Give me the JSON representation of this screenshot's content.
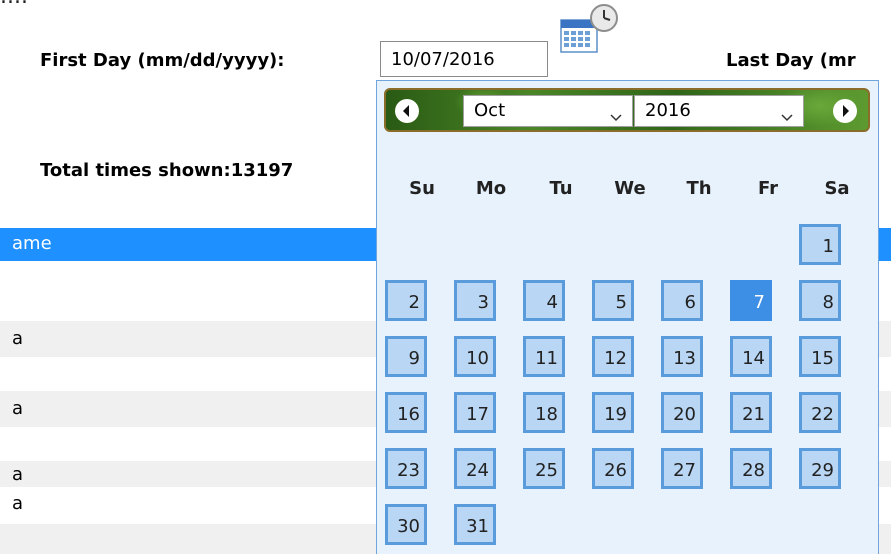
{
  "form": {
    "first_day_label": "First Day (mm/dd/yyyy):",
    "first_day_value": "10/07/2016",
    "last_day_label": "Last Day (mr",
    "total_label": "Total times shown:13197",
    "top_cut_text": "...."
  },
  "table": {
    "header_text": "ame",
    "row_texts": [
      "a",
      "a",
      "a",
      "a"
    ]
  },
  "calendar": {
    "month": "Oct",
    "year": "2016",
    "weekdays": [
      "Su",
      "Mo",
      "Tu",
      "We",
      "Th",
      "Fr",
      "Sa"
    ],
    "selected_day": 7,
    "days": [
      "1",
      "2",
      "3",
      "4",
      "5",
      "6",
      "7",
      "8",
      "9",
      "10",
      "11",
      "12",
      "13",
      "14",
      "15",
      "16",
      "17",
      "18",
      "19",
      "20",
      "21",
      "22",
      "23",
      "24",
      "25",
      "26",
      "27",
      "28",
      "29",
      "30",
      "31"
    ],
    "colors": {
      "selected": "#3d8ee5",
      "cell": "#b9d7f5",
      "cell_border": "#5a9bdb",
      "header_row": "#1e90ff"
    }
  },
  "icons": {
    "calendar_button": "calendar-clock-icon",
    "prev": "chevron-left-icon",
    "next": "chevron-right-icon",
    "dropdown": "chevron-down-icon"
  }
}
